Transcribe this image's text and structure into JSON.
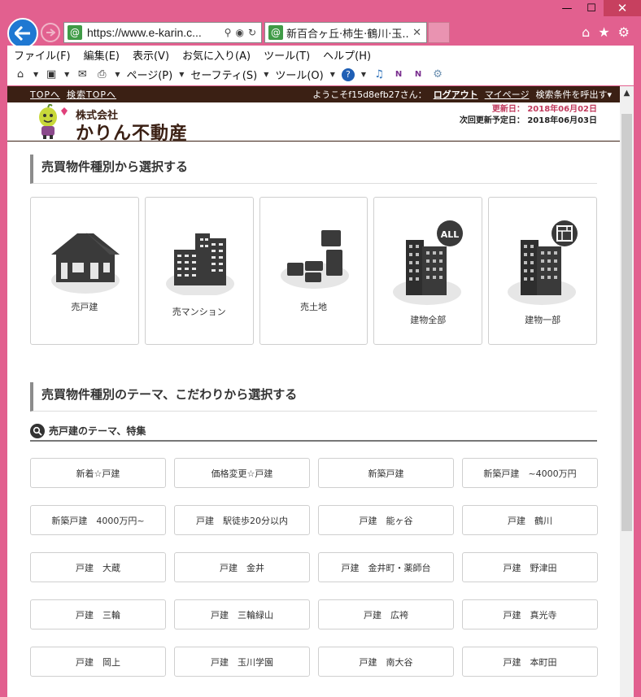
{
  "browser": {
    "url": "https://www.e-karin.c...",
    "tab_title": "新百合ヶ丘·柿生·鶴川·玉...",
    "menu": [
      "ファイル(F)",
      "編集(E)",
      "表示(V)",
      "お気に入り(A)",
      "ツール(T)",
      "ヘルプ(H)"
    ],
    "cmd": {
      "page": "ページ(P)",
      "safety": "セーフティ(S)",
      "tools": "ツール(O)"
    }
  },
  "topbar": {
    "top_link": "TOPへ",
    "search_top_link": "検索TOPへ",
    "welcome": "ようこそf15d8efb27さん：",
    "logout": "ログアウト",
    "mypage": "マイページ",
    "recall": "検索条件を呼出す▾"
  },
  "header": {
    "company_small": "株式会社",
    "company_name": "かりん不動産",
    "updated": "更新日： 2018年06月02日",
    "next_update": "次回更新予定日： 2018年06月03日"
  },
  "section1": {
    "title": "売買物件種別から選択する"
  },
  "types": [
    {
      "label": "売戸建",
      "icon": "house-icon"
    },
    {
      "label": "売マンション",
      "icon": "apartment-icon"
    },
    {
      "label": "売土地",
      "icon": "land-icon"
    },
    {
      "label": "建物全部",
      "icon": "building-all-icon",
      "badge": "ALL"
    },
    {
      "label": "建物一部",
      "icon": "building-part-icon"
    }
  ],
  "section2": {
    "title": "売買物件種別のテーマ、こだわりから選択する"
  },
  "subsection": {
    "title": "売戸建のテーマ、特集"
  },
  "themes": [
    "新着☆戸建",
    "価格変更☆戸建",
    "新築戸建",
    "新築戸建　~4000万円",
    "新築戸建　4000万円~",
    "戸建　駅徒歩20分以内",
    "戸建　能ヶ谷",
    "戸建　鶴川",
    "戸建　大蔵",
    "戸建　金井",
    "戸建　金井町・薬師台",
    "戸建　野津田",
    "戸建　三輪",
    "戸建　三輪緑山",
    "戸建　広袴",
    "戸建　真光寺",
    "戸建　岡上",
    "戸建　玉川学園",
    "戸建　南大谷",
    "戸建　本町田"
  ],
  "colors": {
    "frame": "#e2608f",
    "topbar": "#3b2014",
    "updated": "#c0395c"
  }
}
